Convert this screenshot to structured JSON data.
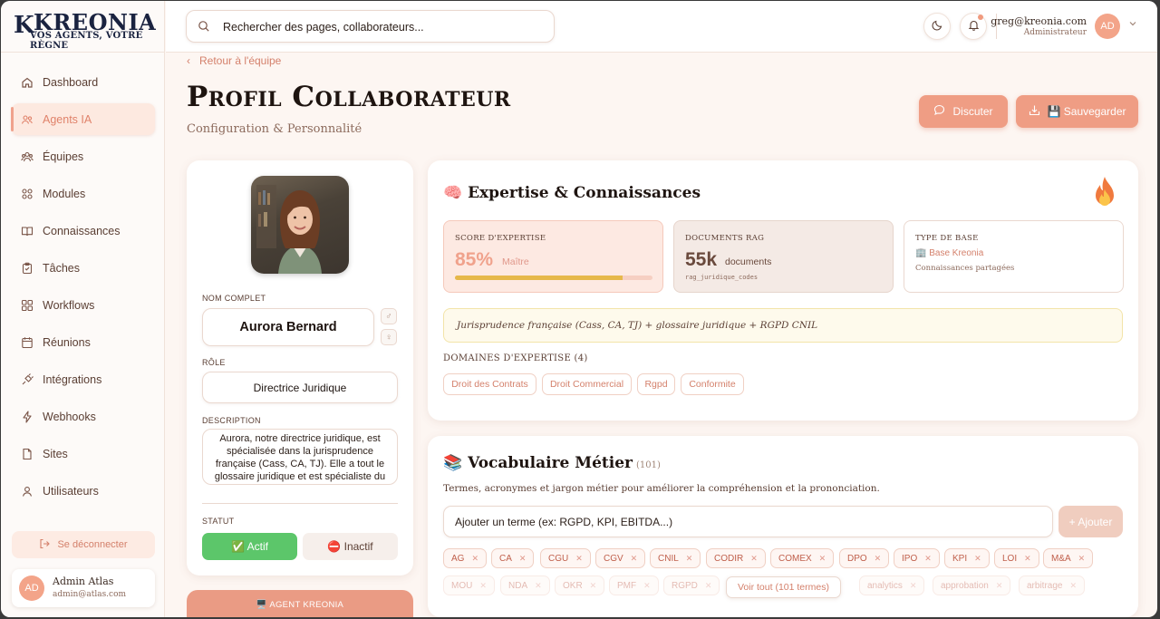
{
  "brand": {
    "mark": "K",
    "name": "KREONIA",
    "tagline": "VOS AGENTS, VOTRE RÈGNE"
  },
  "sidebar": {
    "items": [
      {
        "label": "Dashboard",
        "icon": "home-icon"
      },
      {
        "label": "Agents IA",
        "icon": "users-icon",
        "active": true
      },
      {
        "label": "Équipes",
        "icon": "team-icon"
      },
      {
        "label": "Modules",
        "icon": "grid-icon"
      },
      {
        "label": "Connaissances",
        "icon": "book-icon"
      },
      {
        "label": "Tâches",
        "icon": "clipboard-icon"
      },
      {
        "label": "Workflows",
        "icon": "workflow-icon"
      },
      {
        "label": "Réunions",
        "icon": "calendar-icon"
      },
      {
        "label": "Intégrations",
        "icon": "plug-icon"
      },
      {
        "label": "Webhooks",
        "icon": "bolt-icon"
      },
      {
        "label": "Sites",
        "icon": "document-icon"
      },
      {
        "label": "Utilisateurs",
        "icon": "user-icon"
      }
    ],
    "logout_label": "Se déconnecter",
    "user": {
      "initials": "AD",
      "name": "Admin Atlas",
      "email": "admin@atlas.com"
    }
  },
  "header": {
    "search_placeholder": "Rechercher des pages, collaborateurs...",
    "email": "greg@kreonia.com",
    "role": "Administrateur",
    "initials": "AD"
  },
  "page": {
    "back_label": "Retour à l'équipe",
    "title": "Profil Collaborateur",
    "subtitle": "Configuration & Personnalité",
    "chat_label": "Discuter",
    "save_label": "💾 Sauvegarder"
  },
  "profile": {
    "name_label": "NOM COMPLET",
    "name": "Aurora Bernard",
    "male_symbol": "♂",
    "female_symbol": "♀",
    "role_label": "RÔLE",
    "role": "Directrice Juridique",
    "desc_label": "DESCRIPTION",
    "description": "Aurora, notre directrice juridique, est spécialisée dans la jurisprudence française (Cass, CA, TJ). Elle a tout le glossaire juridique et est spécialiste du RGPD et des recommandations CNIL.",
    "status_label": "STATUT",
    "active_label": "✅ Actif",
    "inactive_label": "⛔ Inactif",
    "agent_banner": "🖥️ AGENT KREONIA"
  },
  "expertise": {
    "title": "🧠 Expertise & Connaissances",
    "score_label": "SCORE D'EXPERTISE",
    "score": "85%",
    "score_level": "Maître",
    "score_fraction": 0.85,
    "rag_label": "DOCUMENTS RAG",
    "rag_count": "55k",
    "rag_unit": "documents",
    "rag_collection": "rag_juridique_codes",
    "base_label": "TYPE DE BASE",
    "base_name": "🏢 Base Kreonia",
    "base_sub": "Connaissances partagées",
    "note": "Jurisprudence française (Cass, CA, TJ) + glossaire juridique + RGPD CNIL",
    "domains_label": "DOMAINES D'EXPERTISE (4)",
    "domains": [
      "Droit des Contrats",
      "Droit Commercial",
      "Rgpd",
      "Conformite"
    ]
  },
  "vocab": {
    "title": "📚 Vocabulaire Métier",
    "count": "(101)",
    "description": "Termes, acronymes et jargon métier pour améliorer la compréhension et la prononciation.",
    "input_placeholder": "Ajouter un terme (ex: RGPD, KPI, EBITDA...)",
    "add_label": "+ Ajouter",
    "row1": [
      "AG",
      "CA",
      "CGU",
      "CGV",
      "CNIL",
      "CODIR",
      "COMEX",
      "DPO",
      "IPO",
      "KPI",
      "LOI",
      "M&A"
    ],
    "row2": [
      "MOU",
      "NDA",
      "OKR",
      "PMF",
      "RGPD",
      "",
      "",
      "analytics",
      "approbation",
      "arbitrage"
    ],
    "see_all_label": "Voir tout (101 termes)"
  },
  "colors": {
    "accent": "#ef9d84",
    "active_green": "#5cc66a",
    "progress": "#e6b84a"
  }
}
